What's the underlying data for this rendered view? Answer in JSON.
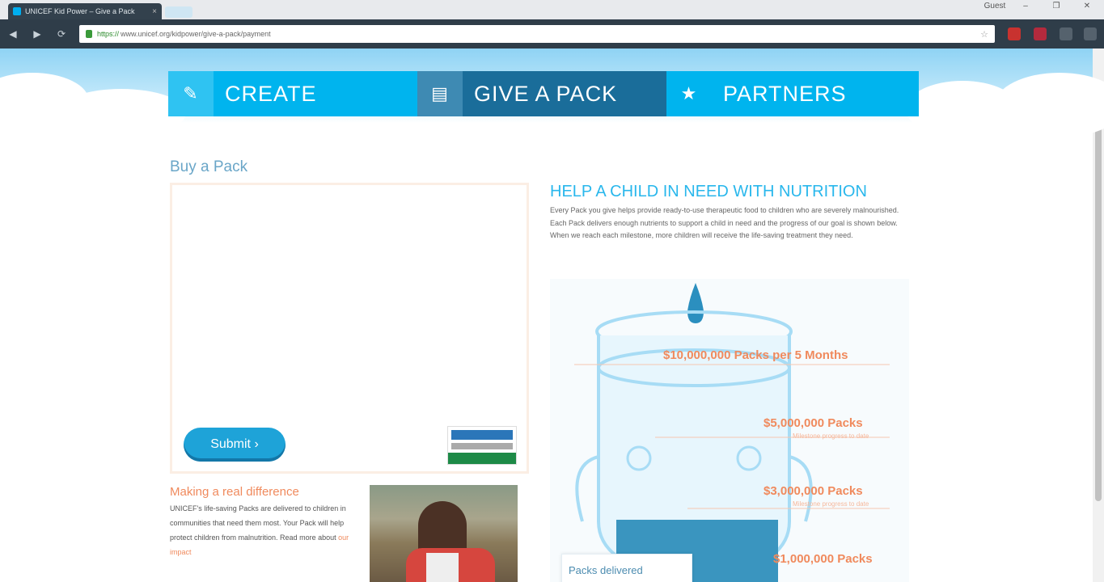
{
  "browser": {
    "tab_title": "UNICEF Kid Power – Give a Pack",
    "tab_close": "×",
    "url_scheme": "https://",
    "url_rest": "www.unicef.org/kidpower/give-a-pack/payment",
    "back_glyph": "◀",
    "forward_glyph": "▶",
    "reload_glyph": "⟳",
    "star_glyph": "☆",
    "window_controls": [
      "–",
      "❐",
      "✕"
    ],
    "user_label": "Guest"
  },
  "nav": {
    "tabs": [
      {
        "label": "CREATE",
        "icon": "pencil-icon",
        "glyph": "✎"
      },
      {
        "label": "GIVE A PACK",
        "icon": "pack-icon",
        "glyph": "▤"
      },
      {
        "label": "PARTNERS",
        "icon": "star-icon",
        "glyph": "★"
      }
    ]
  },
  "payment": {
    "title": "Buy a Pack",
    "submit_label": "Submit ›",
    "seal_alt": "Verified seal"
  },
  "difference": {
    "title": "Making a real difference",
    "body": "UNICEF's life-saving Packs are delivered to children in communities that need them most. Your Pack will help protect children from malnutrition. Read more about",
    "link": "our impact"
  },
  "help": {
    "title": "HELP A CHILD IN NEED WITH NUTRITION",
    "body": "Every Pack you give helps provide ready-to-use therapeutic food to children who are severely malnourished. Each Pack delivers enough nutrients to support a child in need and the progress of our goal is shown below. When we reach each milestone, more children will receive the life-saving treatment they need."
  },
  "milestones": [
    {
      "amount": "$10,000,000 Packs per 5 Months",
      "sub": ""
    },
    {
      "amount": "$5,000,000 Packs",
      "sub": "Milestone progress to date"
    },
    {
      "amount": "$3,000,000 Packs",
      "sub": "Milestone progress to date"
    },
    {
      "amount": "$1,000,000 Packs",
      "sub": ""
    }
  ],
  "jar_tooltip": "Packs delivered",
  "colors": {
    "accent": "#00b4ee",
    "accent_dark": "#1a6d9a",
    "orange": "#f08a5d",
    "water": "#3a95bf"
  }
}
